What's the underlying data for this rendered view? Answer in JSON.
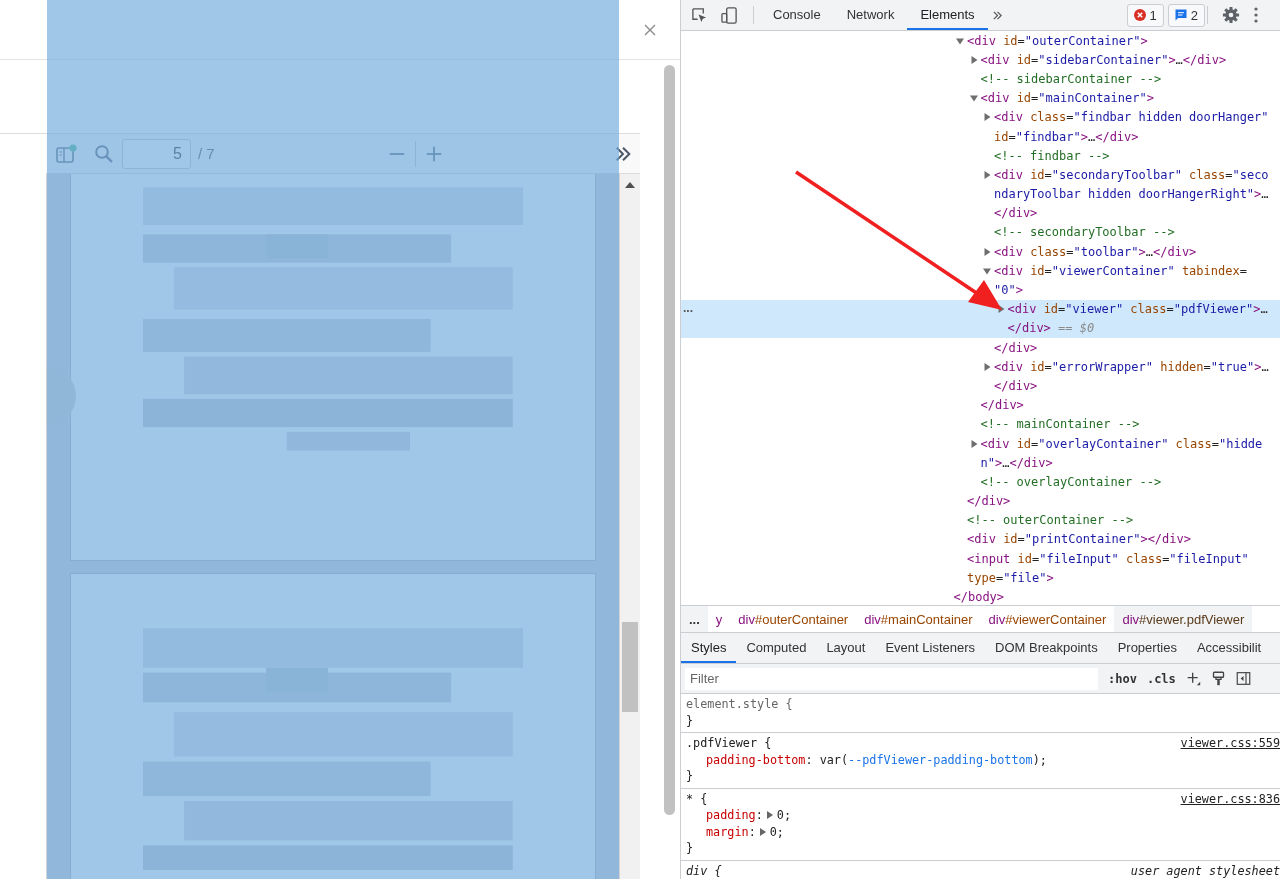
{
  "viewer": {
    "highlighted": true,
    "page_number": "5",
    "page_count": "/ 7"
  },
  "devtools": {
    "tabs": [
      {
        "label": "Console",
        "selected": false
      },
      {
        "label": "Network",
        "selected": false
      },
      {
        "label": "Elements",
        "selected": true
      }
    ],
    "error_count": "1",
    "message_count": "2",
    "dom_tree": {
      "nodes": [
        {
          "kind": "element",
          "expanded": true,
          "selected": false,
          "lines": [
            [
              {
                "kind": "tag",
                "text": "<div"
              },
              {
                "kind": "attr",
                "text": " id"
              },
              {
                "kind": "plain",
                "text": "="
              },
              {
                "kind": "val",
                "text": "\"outerContainer\""
              },
              {
                "kind": "tag",
                "text": ">"
              }
            ]
          ],
          "children": [
            {
              "kind": "element",
              "expanded": false,
              "selected": false,
              "lines": [
                [
                  {
                    "kind": "tag",
                    "text": "<div"
                  },
                  {
                    "kind": "attr",
                    "text": " id"
                  },
                  {
                    "kind": "plain",
                    "text": "="
                  },
                  {
                    "kind": "val",
                    "text": "\"sidebarContainer\""
                  },
                  {
                    "kind": "tag",
                    "text": ">"
                  },
                  {
                    "kind": "plain",
                    "text": "…"
                  },
                  {
                    "kind": "tag",
                    "text": "</div>"
                  }
                ]
              ]
            },
            {
              "kind": "comment",
              "selected": false,
              "lines": [
                [
                  {
                    "kind": "comment",
                    "text": "<!-- sidebarContainer -->"
                  }
                ]
              ]
            },
            {
              "kind": "element",
              "expanded": true,
              "selected": false,
              "lines": [
                [
                  {
                    "kind": "tag",
                    "text": "<div"
                  },
                  {
                    "kind": "attr",
                    "text": " id"
                  },
                  {
                    "kind": "plain",
                    "text": "="
                  },
                  {
                    "kind": "val",
                    "text": "\"mainContainer\""
                  },
                  {
                    "kind": "tag",
                    "text": ">"
                  }
                ]
              ],
              "children": [
                {
                  "kind": "element",
                  "expanded": false,
                  "selected": false,
                  "lines": [
                    [
                      {
                        "kind": "tag",
                        "text": "<div"
                      },
                      {
                        "kind": "attr",
                        "text": " class"
                      },
                      {
                        "kind": "plain",
                        "text": "="
                      },
                      {
                        "kind": "val",
                        "text": "\"findbar hidden doorHanger\""
                      }
                    ],
                    [
                      {
                        "kind": "attr",
                        "text": "id"
                      },
                      {
                        "kind": "plain",
                        "text": "="
                      },
                      {
                        "kind": "val",
                        "text": "\"findbar\""
                      },
                      {
                        "kind": "tag",
                        "text": ">"
                      },
                      {
                        "kind": "plain",
                        "text": "…"
                      },
                      {
                        "kind": "tag",
                        "text": "</div>"
                      }
                    ]
                  ]
                },
                {
                  "kind": "comment",
                  "selected": false,
                  "lines": [
                    [
                      {
                        "kind": "comment",
                        "text": "<!-- findbar -->"
                      }
                    ]
                  ]
                },
                {
                  "kind": "element",
                  "expanded": false,
                  "selected": false,
                  "lines": [
                    [
                      {
                        "kind": "tag",
                        "text": "<div"
                      },
                      {
                        "kind": "attr",
                        "text": " id"
                      },
                      {
                        "kind": "plain",
                        "text": "="
                      },
                      {
                        "kind": "val",
                        "text": "\"secondaryToolbar\""
                      },
                      {
                        "kind": "attr",
                        "text": " class"
                      },
                      {
                        "kind": "plain",
                        "text": "="
                      },
                      {
                        "kind": "val",
                        "text": "\"seco"
                      }
                    ],
                    [
                      {
                        "kind": "val",
                        "text": "ndaryToolbar hidden doorHangerRight\""
                      },
                      {
                        "kind": "tag",
                        "text": ">"
                      },
                      {
                        "kind": "plain",
                        "text": "…"
                      }
                    ],
                    [
                      {
                        "kind": "tag",
                        "text": "</div>"
                      }
                    ]
                  ]
                },
                {
                  "kind": "comment",
                  "selected": false,
                  "lines": [
                    [
                      {
                        "kind": "comment",
                        "text": "<!-- secondaryToolbar -->"
                      }
                    ]
                  ]
                },
                {
                  "kind": "element",
                  "expanded": false,
                  "selected": false,
                  "lines": [
                    [
                      {
                        "kind": "tag",
                        "text": "<div"
                      },
                      {
                        "kind": "attr",
                        "text": " class"
                      },
                      {
                        "kind": "plain",
                        "text": "="
                      },
                      {
                        "kind": "val",
                        "text": "\"toolbar\""
                      },
                      {
                        "kind": "tag",
                        "text": ">"
                      },
                      {
                        "kind": "plain",
                        "text": "…"
                      },
                      {
                        "kind": "tag",
                        "text": "</div>"
                      }
                    ]
                  ]
                },
                {
                  "kind": "element",
                  "expanded": true,
                  "selected": false,
                  "lines": [
                    [
                      {
                        "kind": "tag",
                        "text": "<div"
                      },
                      {
                        "kind": "attr",
                        "text": " id"
                      },
                      {
                        "kind": "plain",
                        "text": "="
                      },
                      {
                        "kind": "val",
                        "text": "\"viewerContainer\""
                      },
                      {
                        "kind": "attr",
                        "text": " tabindex"
                      },
                      {
                        "kind": "plain",
                        "text": "="
                      }
                    ],
                    [
                      {
                        "kind": "val",
                        "text": "\"0\""
                      },
                      {
                        "kind": "tag",
                        "text": ">"
                      }
                    ]
                  ],
                  "children": [
                    {
                      "kind": "element",
                      "expanded": false,
                      "selected": true,
                      "dots": "...",
                      "lines": [
                        [
                          {
                            "kind": "tag",
                            "text": "<div"
                          },
                          {
                            "kind": "attr",
                            "text": " id"
                          },
                          {
                            "kind": "plain",
                            "text": "="
                          },
                          {
                            "kind": "val",
                            "text": "\"viewer\""
                          },
                          {
                            "kind": "attr",
                            "text": " class"
                          },
                          {
                            "kind": "plain",
                            "text": "="
                          },
                          {
                            "kind": "val",
                            "text": "\"pdfViewer\""
                          },
                          {
                            "kind": "tag",
                            "text": ">"
                          },
                          {
                            "kind": "plain",
                            "text": "…"
                          }
                        ],
                        [
                          {
                            "kind": "tag",
                            "text": "</div>"
                          },
                          {
                            "kind": "hint",
                            "text": " == $0"
                          }
                        ]
                      ]
                    }
                  ],
                  "end": [
                    {
                      "kind": "tag",
                      "text": "</div>"
                    }
                  ]
                },
                {
                  "kind": "element",
                  "expanded": false,
                  "selected": false,
                  "lines": [
                    [
                      {
                        "kind": "tag",
                        "text": "<div"
                      },
                      {
                        "kind": "attr",
                        "text": " id"
                      },
                      {
                        "kind": "plain",
                        "text": "="
                      },
                      {
                        "kind": "val",
                        "text": "\"errorWrapper\""
                      },
                      {
                        "kind": "attr",
                        "text": " hidden"
                      },
                      {
                        "kind": "plain",
                        "text": "="
                      },
                      {
                        "kind": "val",
                        "text": "\"true\""
                      },
                      {
                        "kind": "tag",
                        "text": ">"
                      },
                      {
                        "kind": "plain",
                        "text": "…"
                      }
                    ],
                    [
                      {
                        "kind": "tag",
                        "text": "</div>"
                      }
                    ]
                  ]
                }
              ],
              "end": [
                {
                  "kind": "tag",
                  "text": "</div>"
                }
              ]
            },
            {
              "kind": "comment",
              "selected": false,
              "lines": [
                [
                  {
                    "kind": "comment",
                    "text": "<!-- mainContainer -->"
                  }
                ]
              ]
            },
            {
              "kind": "element",
              "expanded": false,
              "selected": false,
              "lines": [
                [
                  {
                    "kind": "tag",
                    "text": "<div"
                  },
                  {
                    "kind": "attr",
                    "text": " id"
                  },
                  {
                    "kind": "plain",
                    "text": "="
                  },
                  {
                    "kind": "val",
                    "text": "\"overlayContainer\""
                  },
                  {
                    "kind": "attr",
                    "text": " class"
                  },
                  {
                    "kind": "plain",
                    "text": "="
                  },
                  {
                    "kind": "val",
                    "text": "\"hidde"
                  }
                ],
                [
                  {
                    "kind": "val",
                    "text": "n\""
                  },
                  {
                    "kind": "tag",
                    "text": ">"
                  },
                  {
                    "kind": "plain",
                    "text": "…"
                  },
                  {
                    "kind": "tag",
                    "text": "</div>"
                  }
                ]
              ]
            },
            {
              "kind": "comment",
              "selected": false,
              "lines": [
                [
                  {
                    "kind": "comment",
                    "text": "<!-- overlayContainer -->"
                  }
                ]
              ]
            }
          ],
          "end": [
            {
              "kind": "tag",
              "text": "</div>"
            }
          ]
        },
        {
          "kind": "comment",
          "selected": false,
          "lines": [
            [
              {
                "kind": "comment",
                "text": "<!-- outerContainer -->"
              }
            ]
          ]
        },
        {
          "kind": "leaf",
          "selected": false,
          "lines": [
            [
              {
                "kind": "tag",
                "text": "<div"
              },
              {
                "kind": "attr",
                "text": " id"
              },
              {
                "kind": "plain",
                "text": "="
              },
              {
                "kind": "val",
                "text": "\"printContainer\""
              },
              {
                "kind": "tag",
                "text": "></div>"
              }
            ]
          ]
        },
        {
          "kind": "leaf",
          "selected": false,
          "lines": [
            [
              {
                "kind": "tag",
                "text": "<input"
              },
              {
                "kind": "attr",
                "text": " id"
              },
              {
                "kind": "plain",
                "text": "="
              },
              {
                "kind": "val",
                "text": "\"fileInput\""
              },
              {
                "kind": "attr",
                "text": " class"
              },
              {
                "kind": "plain",
                "text": "="
              },
              {
                "kind": "val",
                "text": "\"fileInput\""
              }
            ],
            [
              {
                "kind": "attr",
                "text": "type"
              },
              {
                "kind": "plain",
                "text": "="
              },
              {
                "kind": "val",
                "text": "\"file\""
              },
              {
                "kind": "tag",
                "text": ">"
              }
            ]
          ]
        }
      ],
      "end": [
        {
          "kind": "tag",
          "text": "</body>"
        }
      ]
    },
    "breadcrumbs": {
      "overflow": "...",
      "items": [
        {
          "parts": [
            {
              "kind": "tag",
              "text": "y"
            }
          ],
          "selected": false
        },
        {
          "parts": [
            {
              "kind": "tag",
              "text": "div"
            },
            {
              "kind": "attr",
              "text": "#outerContainer"
            }
          ],
          "selected": false
        },
        {
          "parts": [
            {
              "kind": "tag",
              "text": "div"
            },
            {
              "kind": "attr",
              "text": "#mainContainer"
            }
          ],
          "selected": false
        },
        {
          "parts": [
            {
              "kind": "tag",
              "text": "div"
            },
            {
              "kind": "attr",
              "text": "#viewerContainer"
            }
          ],
          "selected": false
        },
        {
          "parts": [
            {
              "kind": "tag",
              "text": "div"
            },
            {
              "kind": "dark",
              "text": "#viewer.pdfViewer"
            }
          ],
          "selected": true
        }
      ]
    },
    "pane_tabs": [
      {
        "label": "Styles",
        "selected": true
      },
      {
        "label": "Computed",
        "selected": false
      },
      {
        "label": "Layout",
        "selected": false
      },
      {
        "label": "Event Listeners",
        "selected": false
      },
      {
        "label": "DOM Breakpoints",
        "selected": false
      },
      {
        "label": "Properties",
        "selected": false
      },
      {
        "label": "Accessibilit",
        "selected": false
      }
    ],
    "filter": {
      "placeholder": "Filter",
      "hov": ":hov",
      "cls": ".cls"
    },
    "rules": [
      {
        "kind": "inline",
        "selector": "element.style",
        "open": "{",
        "close": "}"
      },
      {
        "kind": "author",
        "selector": ".pdfViewer",
        "open": "{",
        "close": "}",
        "source": "viewer.css:559",
        "props": [
          {
            "name": [
              {
                "kind": "prop",
                "text": "padding-bottom"
              },
              {
                "kind": "plain",
                "text": ":"
              }
            ],
            "expandable": false,
            "value": [
              {
                "kind": "plain",
                "text": " var("
              },
              {
                "kind": "var",
                "text": "--pdfViewer-padding-bottom"
              },
              {
                "kind": "plain",
                "text": ");"
              }
            ]
          }
        ]
      },
      {
        "kind": "author",
        "selector": "*",
        "open": "{",
        "close": "}",
        "source": "viewer.css:836",
        "props": [
          {
            "name": [
              {
                "kind": "prop",
                "text": "padding"
              },
              {
                "kind": "plain",
                "text": ":"
              }
            ],
            "expandable": true,
            "value": [
              {
                "kind": "plain",
                "text": "0;"
              }
            ]
          },
          {
            "name": [
              {
                "kind": "prop",
                "text": "margin"
              },
              {
                "kind": "plain",
                "text": ":"
              }
            ],
            "expandable": true,
            "value": [
              {
                "kind": "plain",
                "text": "0;"
              }
            ]
          }
        ]
      },
      {
        "kind": "user_agent",
        "selector": "div",
        "open": "{",
        "source": "user agent stylesheet"
      }
    ]
  }
}
